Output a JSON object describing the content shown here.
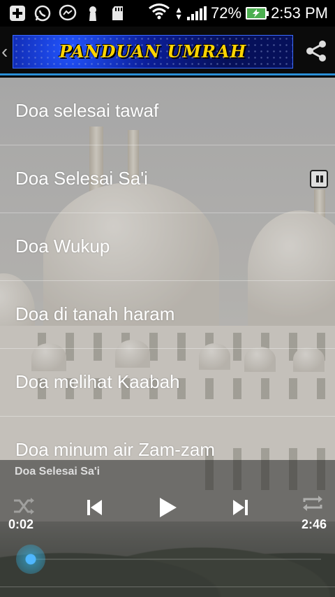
{
  "status_bar": {
    "battery": "72%",
    "time": "2:53 PM",
    "icons": [
      "add-box-icon",
      "whatsapp-icon",
      "messenger-icon",
      "keyhole-icon",
      "sd-card-icon",
      "wifi-icon",
      "signal-icon",
      "battery-charging-icon"
    ]
  },
  "action_bar": {
    "title": "PANDUAN UMRAH",
    "share_icon": "share-icon",
    "accent": "#2a8fd6"
  },
  "list": {
    "items": [
      {
        "label": "Doa selesai tawaf"
      },
      {
        "label": "Doa Selesai Sa'i"
      },
      {
        "label": "Doa Wukup"
      },
      {
        "label": "Doa di tanah haram"
      },
      {
        "label": "Doa melihat Kaabah"
      },
      {
        "label": "Doa minum air Zam-zam"
      }
    ]
  },
  "player": {
    "now_playing": "Doa Selesai Sa'i",
    "current_time": "0:02",
    "total_time": "2:46",
    "progress": 0.012,
    "accent": "#33b5e5"
  }
}
